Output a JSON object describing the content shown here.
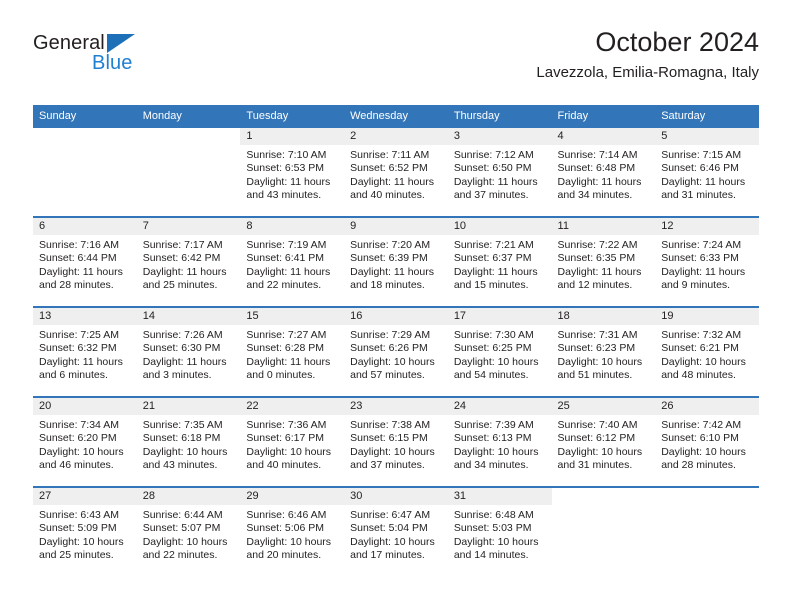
{
  "brand": {
    "name_dark": "General",
    "name_light": "Blue",
    "accent_color": "#1f7fd0",
    "triangle_color": "#1d70b8"
  },
  "header": {
    "month_title": "October 2024",
    "location": "Lavezzola, Emilia-Romagna, Italy",
    "header_bg_color": "#3275b8",
    "day_band_color": "#efefef"
  },
  "calendar": {
    "weekday_headers": [
      "Sunday",
      "Monday",
      "Tuesday",
      "Wednesday",
      "Thursday",
      "Friday",
      "Saturday"
    ],
    "weeks": [
      [
        {
          "day": "",
          "sunrise": "",
          "sunset": "",
          "daylight": ""
        },
        {
          "day": "",
          "sunrise": "",
          "sunset": "",
          "daylight": ""
        },
        {
          "day": "1",
          "sunrise": "Sunrise: 7:10 AM",
          "sunset": "Sunset: 6:53 PM",
          "daylight": "Daylight: 11 hours and 43 minutes."
        },
        {
          "day": "2",
          "sunrise": "Sunrise: 7:11 AM",
          "sunset": "Sunset: 6:52 PM",
          "daylight": "Daylight: 11 hours and 40 minutes."
        },
        {
          "day": "3",
          "sunrise": "Sunrise: 7:12 AM",
          "sunset": "Sunset: 6:50 PM",
          "daylight": "Daylight: 11 hours and 37 minutes."
        },
        {
          "day": "4",
          "sunrise": "Sunrise: 7:14 AM",
          "sunset": "Sunset: 6:48 PM",
          "daylight": "Daylight: 11 hours and 34 minutes."
        },
        {
          "day": "5",
          "sunrise": "Sunrise: 7:15 AM",
          "sunset": "Sunset: 6:46 PM",
          "daylight": "Daylight: 11 hours and 31 minutes."
        }
      ],
      [
        {
          "day": "6",
          "sunrise": "Sunrise: 7:16 AM",
          "sunset": "Sunset: 6:44 PM",
          "daylight": "Daylight: 11 hours and 28 minutes."
        },
        {
          "day": "7",
          "sunrise": "Sunrise: 7:17 AM",
          "sunset": "Sunset: 6:42 PM",
          "daylight": "Daylight: 11 hours and 25 minutes."
        },
        {
          "day": "8",
          "sunrise": "Sunrise: 7:19 AM",
          "sunset": "Sunset: 6:41 PM",
          "daylight": "Daylight: 11 hours and 22 minutes."
        },
        {
          "day": "9",
          "sunrise": "Sunrise: 7:20 AM",
          "sunset": "Sunset: 6:39 PM",
          "daylight": "Daylight: 11 hours and 18 minutes."
        },
        {
          "day": "10",
          "sunrise": "Sunrise: 7:21 AM",
          "sunset": "Sunset: 6:37 PM",
          "daylight": "Daylight: 11 hours and 15 minutes."
        },
        {
          "day": "11",
          "sunrise": "Sunrise: 7:22 AM",
          "sunset": "Sunset: 6:35 PM",
          "daylight": "Daylight: 11 hours and 12 minutes."
        },
        {
          "day": "12",
          "sunrise": "Sunrise: 7:24 AM",
          "sunset": "Sunset: 6:33 PM",
          "daylight": "Daylight: 11 hours and 9 minutes."
        }
      ],
      [
        {
          "day": "13",
          "sunrise": "Sunrise: 7:25 AM",
          "sunset": "Sunset: 6:32 PM",
          "daylight": "Daylight: 11 hours and 6 minutes."
        },
        {
          "day": "14",
          "sunrise": "Sunrise: 7:26 AM",
          "sunset": "Sunset: 6:30 PM",
          "daylight": "Daylight: 11 hours and 3 minutes."
        },
        {
          "day": "15",
          "sunrise": "Sunrise: 7:27 AM",
          "sunset": "Sunset: 6:28 PM",
          "daylight": "Daylight: 11 hours and 0 minutes."
        },
        {
          "day": "16",
          "sunrise": "Sunrise: 7:29 AM",
          "sunset": "Sunset: 6:26 PM",
          "daylight": "Daylight: 10 hours and 57 minutes."
        },
        {
          "day": "17",
          "sunrise": "Sunrise: 7:30 AM",
          "sunset": "Sunset: 6:25 PM",
          "daylight": "Daylight: 10 hours and 54 minutes."
        },
        {
          "day": "18",
          "sunrise": "Sunrise: 7:31 AM",
          "sunset": "Sunset: 6:23 PM",
          "daylight": "Daylight: 10 hours and 51 minutes."
        },
        {
          "day": "19",
          "sunrise": "Sunrise: 7:32 AM",
          "sunset": "Sunset: 6:21 PM",
          "daylight": "Daylight: 10 hours and 48 minutes."
        }
      ],
      [
        {
          "day": "20",
          "sunrise": "Sunrise: 7:34 AM",
          "sunset": "Sunset: 6:20 PM",
          "daylight": "Daylight: 10 hours and 46 minutes."
        },
        {
          "day": "21",
          "sunrise": "Sunrise: 7:35 AM",
          "sunset": "Sunset: 6:18 PM",
          "daylight": "Daylight: 10 hours and 43 minutes."
        },
        {
          "day": "22",
          "sunrise": "Sunrise: 7:36 AM",
          "sunset": "Sunset: 6:17 PM",
          "daylight": "Daylight: 10 hours and 40 minutes."
        },
        {
          "day": "23",
          "sunrise": "Sunrise: 7:38 AM",
          "sunset": "Sunset: 6:15 PM",
          "daylight": "Daylight: 10 hours and 37 minutes."
        },
        {
          "day": "24",
          "sunrise": "Sunrise: 7:39 AM",
          "sunset": "Sunset: 6:13 PM",
          "daylight": "Daylight: 10 hours and 34 minutes."
        },
        {
          "day": "25",
          "sunrise": "Sunrise: 7:40 AM",
          "sunset": "Sunset: 6:12 PM",
          "daylight": "Daylight: 10 hours and 31 minutes."
        },
        {
          "day": "26",
          "sunrise": "Sunrise: 7:42 AM",
          "sunset": "Sunset: 6:10 PM",
          "daylight": "Daylight: 10 hours and 28 minutes."
        }
      ],
      [
        {
          "day": "27",
          "sunrise": "Sunrise: 6:43 AM",
          "sunset": "Sunset: 5:09 PM",
          "daylight": "Daylight: 10 hours and 25 minutes."
        },
        {
          "day": "28",
          "sunrise": "Sunrise: 6:44 AM",
          "sunset": "Sunset: 5:07 PM",
          "daylight": "Daylight: 10 hours and 22 minutes."
        },
        {
          "day": "29",
          "sunrise": "Sunrise: 6:46 AM",
          "sunset": "Sunset: 5:06 PM",
          "daylight": "Daylight: 10 hours and 20 minutes."
        },
        {
          "day": "30",
          "sunrise": "Sunrise: 6:47 AM",
          "sunset": "Sunset: 5:04 PM",
          "daylight": "Daylight: 10 hours and 17 minutes."
        },
        {
          "day": "31",
          "sunrise": "Sunrise: 6:48 AM",
          "sunset": "Sunset: 5:03 PM",
          "daylight": "Daylight: 10 hours and 14 minutes."
        },
        {
          "day": "",
          "sunrise": "",
          "sunset": "",
          "daylight": ""
        },
        {
          "day": "",
          "sunrise": "",
          "sunset": "",
          "daylight": ""
        }
      ]
    ]
  }
}
